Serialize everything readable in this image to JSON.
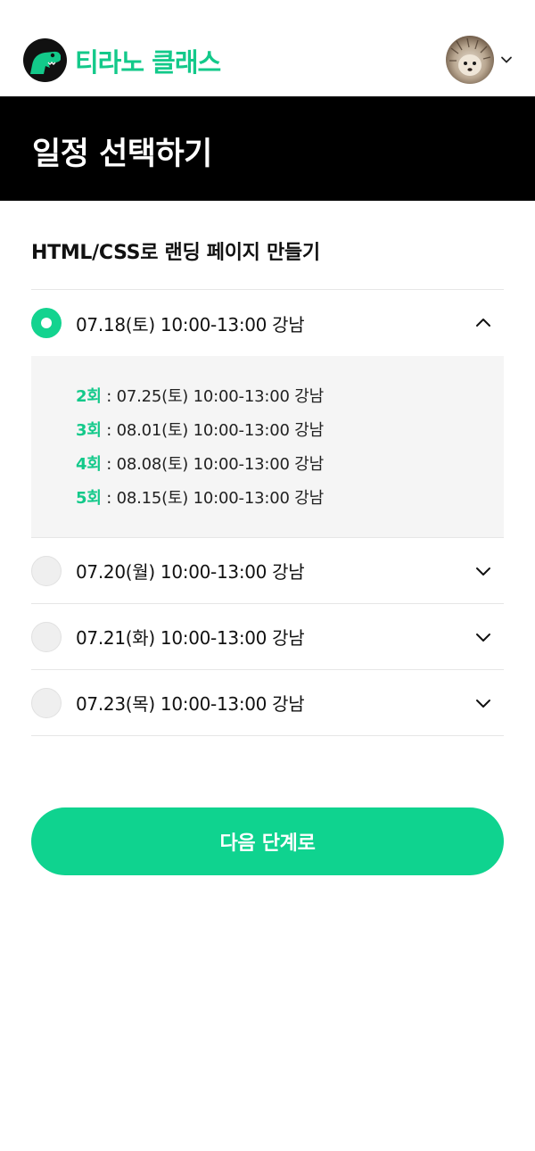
{
  "header": {
    "logo_text": "티라노 클래스",
    "brand_color": "#13C98A"
  },
  "page_title": "일정 선택하기",
  "course_title": "HTML/CSS로 랜딩 페이지 만들기",
  "options": [
    {
      "label": "07.18(토) 10:00-13:00 강남",
      "selected": true,
      "expanded": true,
      "sessions": [
        {
          "round": "2회",
          "text": " : 07.25(토) 10:00-13:00 강남"
        },
        {
          "round": "3회",
          "text": " : 08.01(토) 10:00-13:00 강남"
        },
        {
          "round": "4회",
          "text": " : 08.08(토) 10:00-13:00 강남"
        },
        {
          "round": "5회",
          "text": " : 08.15(토) 10:00-13:00 강남"
        }
      ]
    },
    {
      "label": "07.20(월) 10:00-13:00 강남",
      "selected": false,
      "expanded": false
    },
    {
      "label": "07.21(화) 10:00-13:00 강남",
      "selected": false,
      "expanded": false
    },
    {
      "label": "07.23(목) 10:00-13:00 강남",
      "selected": false,
      "expanded": false
    }
  ],
  "cta_label": "다음 단계로",
  "icons": {
    "logo": "dinosaur-logo-icon",
    "profile_menu": "chevron-down-icon",
    "expand": "chevron-down-icon",
    "collapse": "chevron-up-icon"
  }
}
